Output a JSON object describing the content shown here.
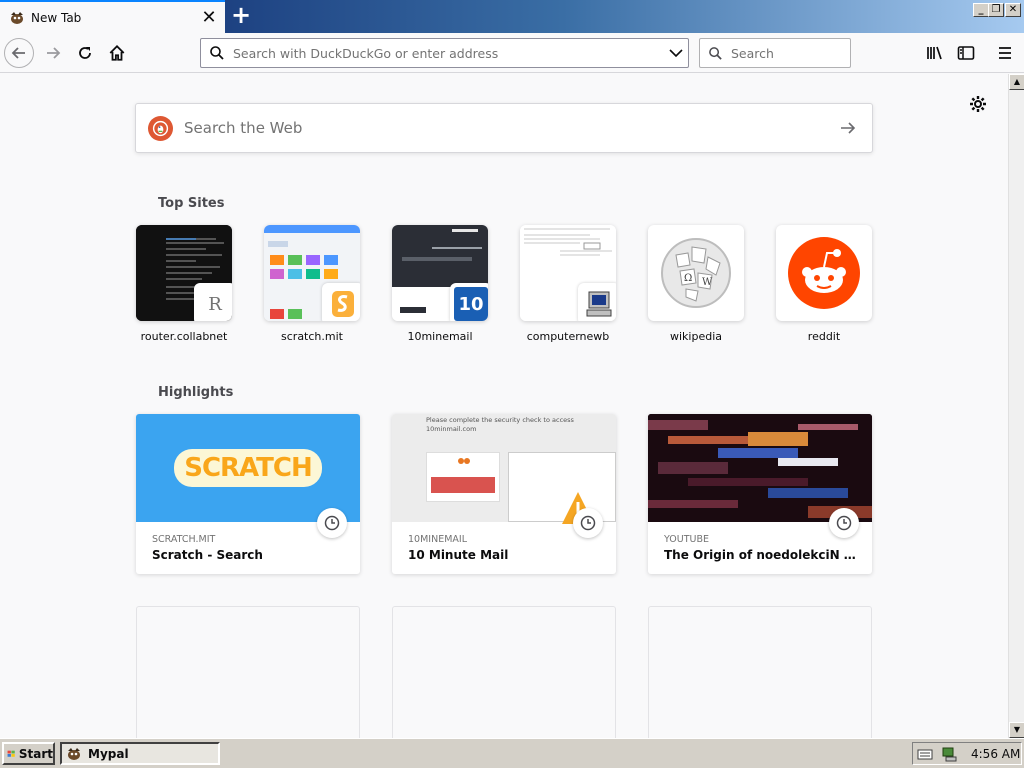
{
  "tab": {
    "title": "New Tab",
    "close": "✕",
    "new": "+"
  },
  "window": {
    "min": "_",
    "max": "❐",
    "close": "✕"
  },
  "toolbar": {
    "url_placeholder": "Search with DuckDuckGo or enter address",
    "search_placeholder": "Search"
  },
  "newtab": {
    "search_placeholder": "Search the Web",
    "topsites_title": "Top Sites",
    "highlights_title": "Highlights",
    "topsites": [
      {
        "label": "router.collabnet",
        "badge": "R"
      },
      {
        "label": "scratch.mit"
      },
      {
        "label": "10minemail",
        "badge": "10"
      },
      {
        "label": "computernewb"
      },
      {
        "label": "wikipedia"
      },
      {
        "label": "reddit"
      }
    ],
    "highlights": [
      {
        "source": "SCRATCH.MIT",
        "title": "Scratch - Search",
        "preview_text": "SCRATCH"
      },
      {
        "source": "10MINEMAIL",
        "title": "10 Minute Mail",
        "preview_text": "Please complete the security check to access 10minmail.com"
      },
      {
        "source": "YOUTUBE",
        "title": "The Origin of noedolekciN (Nick..."
      }
    ]
  },
  "taskbar": {
    "start": "Start",
    "app": "Mypal",
    "time": "4:56 AM"
  },
  "colors": {
    "accent": "#0a84ff",
    "scratch_bg": "#3ba4f0",
    "reddit": "#ff4500",
    "ddg": "#de5833"
  }
}
